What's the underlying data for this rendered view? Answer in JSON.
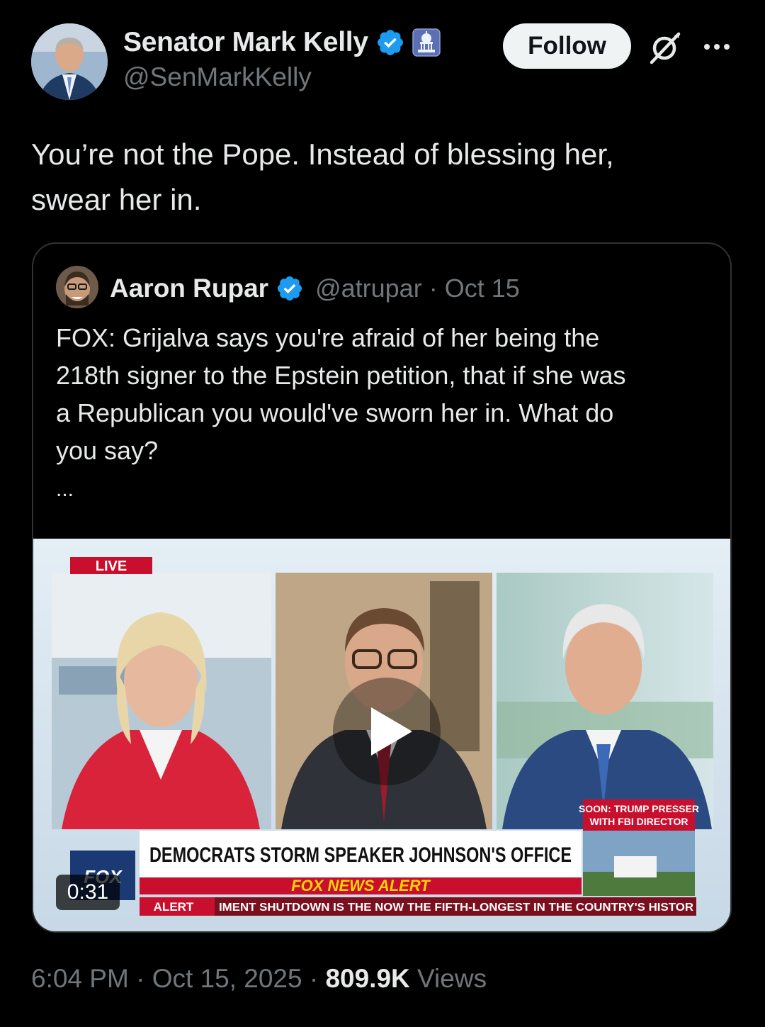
{
  "author": {
    "display_name": "Senator Mark Kelly",
    "handle": "@SenMarkKelly",
    "badges": [
      "verified-badge-icon",
      "capitol-government-icon"
    ]
  },
  "actions": {
    "follow_label": "Follow",
    "grok_icon": "grok-icon",
    "more_icon": "more-icon"
  },
  "tweet": {
    "text_line1": "You’re not the Pope. Instead of blessing her,",
    "text_line2": "swear her in."
  },
  "quote": {
    "display_name": "Aaron Rupar",
    "handle": "@atrupar",
    "separator": "·",
    "date": "Oct 15",
    "text_lines": [
      "FOX: Grijalva says you're afraid of her being the",
      "218th signer to the Epstein petition, that if she was",
      "a Republican you would've sworn her in. What do",
      "you say?"
    ],
    "ellipsis": "...",
    "video": {
      "duration": "0:31",
      "live_tag": "LIVE",
      "headline": "DEMOCRATS STORM SPEAKER JOHNSON'S OFFICE",
      "alert_banner": "FOX NEWS ALERT",
      "ticker_label": "ALERT",
      "ticker_text": "IMENT SHUTDOWN IS THE NOW THE FIFTH-LONGEST IN THE COUNTRY'S HISTOR",
      "soon_line1": "SOON: TRUMP PRESSER",
      "soon_line2": "WITH FBI DIRECTOR",
      "network_logo": "FOX"
    }
  },
  "footer": {
    "time": "6:04 PM",
    "dot": "·",
    "date": "Oct 15, 2025",
    "views_count": "809.9K",
    "views_label": "Views"
  },
  "colors": {
    "background": "#000000",
    "text_primary": "#e7e9ea",
    "text_secondary": "#71767b",
    "verified_blue": "#1d9bf0",
    "fox_red": "#c8102e"
  }
}
